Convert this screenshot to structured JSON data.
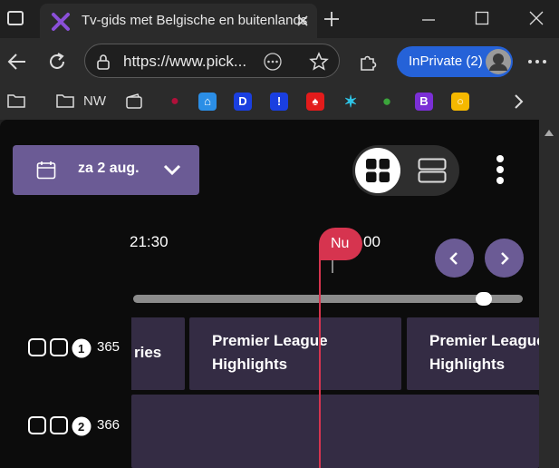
{
  "browser": {
    "tab_title": "Tv-gids met Belgische en buitenlandse zenders",
    "url": "https://www.pick...",
    "inprivate_label": "InPrivate (2)",
    "favorites": [
      {
        "name": "folder-icon",
        "label": ""
      },
      {
        "name": "folder-nw",
        "label": "NW"
      }
    ]
  },
  "page": {
    "date_label": "za 2 aug.",
    "timeline": {
      "label_left": "21:30",
      "label_right": "00",
      "now_label": "Nu"
    },
    "progress": 0.918,
    "channels": [
      {
        "number": "365",
        "sport": "1"
      },
      {
        "number": "366",
        "sport": "2"
      }
    ],
    "row1_programs": [
      {
        "title": "ries"
      },
      {
        "title": "Premier League\nHighlights"
      },
      {
        "title": "Premier League\nHighlights"
      }
    ]
  },
  "colors": {
    "accent": "#6b5b95",
    "now_red": "#d6344f",
    "program_bg": "#342c44",
    "inprivate_blue": "#2562d8"
  }
}
